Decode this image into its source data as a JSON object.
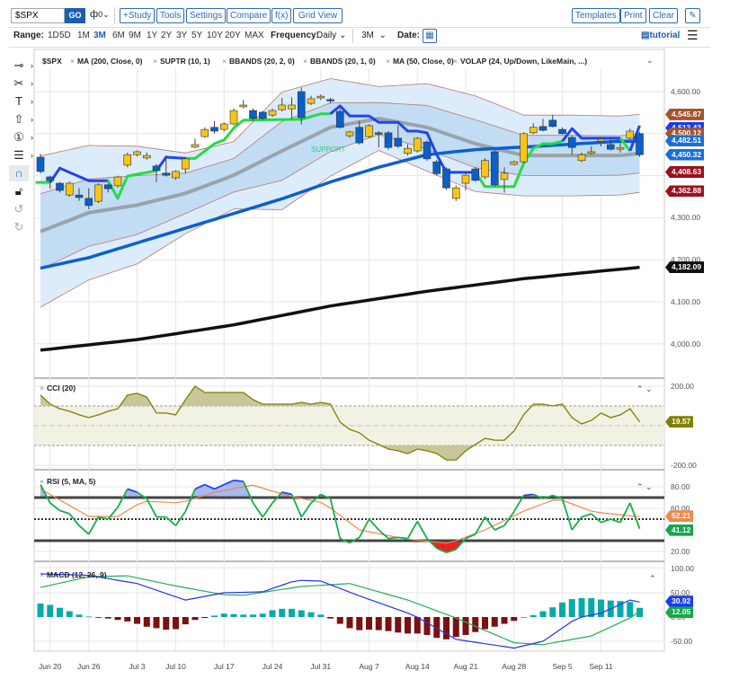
{
  "toolbar": {
    "symbol": "$SPX",
    "go": "GO",
    "chart_type_icon": "candlestick-icon",
    "buttons": [
      "+Study",
      "Tools",
      "Settings",
      "Compare",
      "f(x)",
      "Grid View"
    ],
    "right_buttons": [
      "Templates",
      "Print",
      "Clear"
    ],
    "edit_icon": "pencil-icon"
  },
  "range": {
    "label": "Range:",
    "items": [
      "1D",
      "5D",
      "1M",
      "3M",
      "6M",
      "9M",
      "1Y",
      "2Y",
      "3Y",
      "5Y",
      "10Y",
      "20Y",
      "MAX"
    ],
    "selected": "3M",
    "frequency_label": "Frequency:",
    "frequency": "Daily",
    "period": "3M",
    "date_label": "Date:",
    "tutorial": "tutorial"
  },
  "legend": {
    "symbol": "$SPX",
    "studies": [
      "MA (200, Close, 0)",
      "SUPTR (10, 1)",
      "BBANDS (20, 2, 0)",
      "BBANDS (20, 1, 0)",
      "MA (50, Close, 0)",
      "VOLAP (24, Up/Down, LikeMain, ...)"
    ]
  },
  "annotation": "SUPPORT",
  "tools": [
    "line-tool-icon",
    "scissors-icon",
    "text-icon",
    "arrow-up-icon",
    "numbered-marker-icon",
    "fib-lines-icon",
    "magnet-icon",
    "lock-icon",
    "undo-icon",
    "redo-icon"
  ],
  "colors": {
    "up": "#f5c518",
    "down": "#0a5fc8",
    "ma200": "#111111",
    "ma50": "#0a5fd0",
    "mid": "#9aa3ab",
    "suptr_up": "#22dd44",
    "suptr_down": "#2244ee"
  },
  "main_axis": [
    {
      "label": "4,600.00",
      "v": 4600
    },
    {
      "label": "4,300.00",
      "v": 4300
    },
    {
      "label": "4,200.00",
      "v": 4200
    },
    {
      "label": "4,100.00",
      "v": 4100
    },
    {
      "label": "4,000.00",
      "v": 4000
    }
  ],
  "price_tags": [
    {
      "label": "4,545.87",
      "v": 4545.87,
      "color": "#a5532a"
    },
    {
      "label": "4,513.43",
      "v": 4513.43,
      "color": "#1a3cf0"
    },
    {
      "label": "4,500.12",
      "v": 4500.12,
      "color": "#a5532a"
    },
    {
      "label": "4,482.51",
      "v": 4482.51,
      "color": "#1a6fd6"
    },
    {
      "label": "4,450.32",
      "v": 4450.32,
      "color": "#1a6fd6"
    },
    {
      "label": "4,408.63",
      "v": 4408.63,
      "color": "#9b111e"
    },
    {
      "label": "4,362.88",
      "v": 4362.88,
      "color": "#9b111e"
    },
    {
      "label": "4,182.09",
      "v": 4182.09,
      "color": "#111111"
    }
  ],
  "x_labels": [
    {
      "label": "Jun 20",
      "i": 1
    },
    {
      "label": "Jun 26",
      "i": 5
    },
    {
      "label": "Jul 3",
      "i": 10
    },
    {
      "label": "Jul 10",
      "i": 14
    },
    {
      "label": "Jul 17",
      "i": 19
    },
    {
      "label": "Jul 24",
      "i": 24
    },
    {
      "label": "Jul 31",
      "i": 29
    },
    {
      "label": "Aug 7",
      "i": 34
    },
    {
      "label": "Aug 14",
      "i": 39
    },
    {
      "label": "Aug 21",
      "i": 44
    },
    {
      "label": "Aug 28",
      "i": 49
    },
    {
      "label": "Sep 5",
      "i": 54
    },
    {
      "label": "Sep 11",
      "i": 58
    }
  ],
  "chart_data": {
    "type": "candlestick",
    "ohlc": [
      [
        4444,
        4452,
        4405,
        4410
      ],
      [
        4397,
        4400,
        4369,
        4388
      ],
      [
        4382,
        4385,
        4360,
        4365
      ],
      [
        4354,
        4386,
        4350,
        4382
      ],
      [
        4354,
        4370,
        4340,
        4348
      ],
      [
        4346,
        4370,
        4320,
        4329
      ],
      [
        4339,
        4382,
        4335,
        4378
      ],
      [
        4378,
        4382,
        4360,
        4369
      ],
      [
        4376,
        4400,
        4372,
        4397
      ],
      [
        4425,
        4455,
        4420,
        4450
      ],
      [
        4450,
        4460,
        4446,
        4457
      ],
      [
        4442,
        4455,
        4438,
        4448
      ],
      [
        4423,
        4428,
        4385,
        4412
      ],
      [
        4406,
        4448,
        4398,
        4401
      ],
      [
        4395,
        4413,
        4390,
        4410
      ],
      [
        4416,
        4445,
        4405,
        4440
      ],
      [
        4468,
        4488,
        4465,
        4474
      ],
      [
        4493,
        4515,
        4490,
        4510
      ],
      [
        4515,
        4530,
        4500,
        4506
      ],
      [
        4510,
        4527,
        4505,
        4523
      ],
      [
        4523,
        4560,
        4520,
        4555
      ],
      [
        4564,
        4580,
        4560,
        4568
      ],
      [
        4555,
        4560,
        4530,
        4536
      ],
      [
        4551,
        4554,
        4533,
        4536
      ],
      [
        4544,
        4560,
        4540,
        4555
      ],
      [
        4557,
        4585,
        4553,
        4568
      ],
      [
        4559,
        4586,
        4535,
        4568
      ],
      [
        4600,
        4610,
        4522,
        4538
      ],
      [
        4572,
        4590,
        4568,
        4583
      ],
      [
        4585,
        4593,
        4580,
        4589
      ],
      [
        4581,
        4585,
        4572,
        4580
      ],
      [
        4553,
        4560,
        4512,
        4515
      ],
      [
        4495,
        4507,
        4490,
        4504
      ],
      [
        4515,
        4530,
        4474,
        4478
      ],
      [
        4493,
        4522,
        4490,
        4519
      ],
      [
        4502,
        4506,
        4467,
        4501
      ],
      [
        4502,
        4506,
        4462,
        4467
      ],
      [
        4489,
        4520,
        4465,
        4470
      ],
      [
        4453,
        4475,
        4448,
        4465
      ],
      [
        4459,
        4492,
        4455,
        4489
      ],
      [
        4480,
        4484,
        4435,
        4440
      ],
      [
        4433,
        4438,
        4400,
        4405
      ],
      [
        4416,
        4420,
        4366,
        4371
      ],
      [
        4346,
        4377,
        4340,
        4371
      ],
      [
        4382,
        4410,
        4365,
        4401
      ],
      [
        4416,
        4420,
        4385,
        4389
      ],
      [
        4397,
        4442,
        4392,
        4436
      ],
      [
        4457,
        4461,
        4374,
        4378
      ],
      [
        4391,
        4420,
        4360,
        4406
      ],
      [
        4427,
        4436,
        4424,
        4433
      ],
      [
        4433,
        4503,
        4430,
        4500
      ],
      [
        4502,
        4525,
        4499,
        4515
      ],
      [
        4517,
        4535,
        4505,
        4508
      ],
      [
        4532,
        4545,
        4515,
        4517
      ],
      [
        4510,
        4515,
        4498,
        4500
      ],
      [
        4491,
        4495,
        4450,
        4467
      ],
      [
        4436,
        4455,
        4432,
        4450
      ],
      [
        4453,
        4470,
        4450,
        4457
      ],
      [
        4482,
        4492,
        4470,
        4487
      ],
      [
        4474,
        4487,
        4460,
        4463
      ],
      [
        4463,
        4478,
        4455,
        4467
      ],
      [
        4489,
        4512,
        4485,
        4506
      ],
      [
        4500,
        4504,
        4445,
        4450
      ]
    ],
    "ma200": [
      [
        0,
        3985
      ],
      [
        10,
        4010
      ],
      [
        20,
        4045
      ],
      [
        30,
        4090
      ],
      [
        40,
        4125
      ],
      [
        50,
        4155
      ],
      [
        62,
        4182
      ]
    ],
    "ma50": [
      [
        0,
        4180
      ],
      [
        5,
        4205
      ],
      [
        10,
        4240
      ],
      [
        15,
        4275
      ],
      [
        20,
        4310
      ],
      [
        25,
        4345
      ],
      [
        30,
        4385
      ],
      [
        35,
        4420
      ],
      [
        40,
        4450
      ],
      [
        45,
        4462
      ],
      [
        50,
        4468
      ],
      [
        55,
        4475
      ],
      [
        60,
        4482
      ],
      [
        62,
        4482
      ]
    ],
    "bb_mid": [
      [
        0,
        4267
      ],
      [
        5,
        4312
      ],
      [
        10,
        4330
      ],
      [
        15,
        4358
      ],
      [
        20,
        4401
      ],
      [
        25,
        4459
      ],
      [
        30,
        4515
      ],
      [
        35,
        4536
      ],
      [
        40,
        4515
      ],
      [
        45,
        4476
      ],
      [
        50,
        4448
      ],
      [
        55,
        4448
      ],
      [
        60,
        4448
      ],
      [
        62,
        4453
      ]
    ],
    "bb_sigma": [
      [
        0,
        90
      ],
      [
        5,
        80
      ],
      [
        10,
        70
      ],
      [
        15,
        48
      ],
      [
        20,
        40
      ],
      [
        25,
        70
      ],
      [
        30,
        58
      ],
      [
        35,
        38
      ],
      [
        40,
        52
      ],
      [
        45,
        57
      ],
      [
        50,
        48
      ],
      [
        55,
        48
      ],
      [
        60,
        47
      ],
      [
        62,
        46.4
      ]
    ],
    "suptr": [
      {
        "trend": "up",
        "pts": [
          [
            -0.5,
            4384
          ],
          [
            1,
            4384
          ]
        ]
      },
      {
        "trend": "down",
        "pts": [
          [
            1,
            4384
          ],
          [
            2,
            4418
          ],
          [
            5,
            4388
          ],
          [
            7,
            4388
          ]
        ]
      },
      {
        "trend": "up",
        "pts": [
          [
            7,
            4388
          ],
          [
            8,
            4346
          ],
          [
            9,
            4399
          ],
          [
            12,
            4412
          ]
        ]
      },
      {
        "trend": "down",
        "pts": [
          [
            12,
            4412
          ],
          [
            13,
            4444
          ],
          [
            15,
            4441
          ]
        ]
      },
      {
        "trend": "up",
        "pts": [
          [
            15,
            4441
          ],
          [
            16,
            4441
          ],
          [
            18,
            4476
          ],
          [
            19,
            4485
          ],
          [
            20,
            4513
          ],
          [
            21,
            4532
          ],
          [
            27,
            4534
          ],
          [
            29,
            4547
          ],
          [
            30,
            4547
          ]
        ]
      },
      {
        "trend": "down",
        "pts": [
          [
            30,
            4547
          ],
          [
            31,
            4566
          ],
          [
            32,
            4542
          ],
          [
            34,
            4542
          ],
          [
            35,
            4527
          ],
          [
            37,
            4527
          ],
          [
            38,
            4506
          ],
          [
            39,
            4506
          ],
          [
            40,
            4502
          ],
          [
            41,
            4450
          ],
          [
            42,
            4408
          ],
          [
            45,
            4408
          ]
        ]
      },
      {
        "trend": "up",
        "pts": [
          [
            45,
            4408
          ],
          [
            46,
            4374
          ],
          [
            48,
            4374
          ],
          [
            49,
            4374
          ],
          [
            50,
            4429
          ],
          [
            51,
            4465
          ],
          [
            52,
            4476
          ],
          [
            53,
            4476
          ],
          [
            54,
            4482
          ]
        ]
      },
      {
        "trend": "down",
        "pts": [
          [
            54,
            4482
          ],
          [
            55,
            4512
          ],
          [
            56,
            4489
          ],
          [
            60,
            4489
          ]
        ]
      },
      {
        "trend": "up",
        "pts": [
          [
            60,
            4489
          ],
          [
            61,
            4459
          ]
        ]
      },
      {
        "trend": "down",
        "pts": [
          [
            61,
            4459
          ],
          [
            62,
            4519
          ]
        ]
      }
    ],
    "ylim": [
      4000,
      4600
    ]
  },
  "cci": {
    "title": "CCI (20)",
    "axis": [
      "200.00",
      "-200.00"
    ],
    "tag": "19.57",
    "tag_color": "#808000",
    "values": [
      155,
      109,
      86,
      73,
      55,
      41,
      55,
      73,
      86,
      155,
      164,
      145,
      64,
      64,
      55,
      132,
      200,
      168,
      168,
      168,
      168,
      168,
      132,
      109,
      109,
      109,
      109,
      118,
      109,
      118,
      109,
      18,
      -18,
      -36,
      -73,
      -95,
      -118,
      -127,
      -141,
      -118,
      -127,
      -141,
      -173,
      -173,
      -127,
      -95,
      -64,
      -73,
      -73,
      -27,
      55,
      109,
      109,
      100,
      109,
      41,
      9,
      27,
      64,
      41,
      55,
      86,
      19.57
    ]
  },
  "rsi": {
    "title": "RSI (5, MA, 5)",
    "axis": [
      "80.00",
      "60.00",
      "20.00"
    ],
    "tags": [
      {
        "label": "52.21",
        "color": "#f0884a"
      },
      {
        "label": "41.12",
        "color": "#13a84a"
      }
    ],
    "values": [
      82,
      65,
      58,
      55,
      44,
      36,
      52,
      50,
      61,
      78,
      75,
      69,
      52,
      52,
      44,
      57,
      78,
      82,
      78,
      82,
      86,
      85,
      65,
      52,
      65,
      75,
      73,
      52,
      65,
      73,
      69,
      32,
      28,
      33,
      50,
      40,
      32,
      33,
      32,
      48,
      32,
      23,
      19,
      22,
      32,
      36,
      52,
      40,
      44,
      57,
      72,
      73,
      69,
      72,
      69,
      40,
      52,
      55,
      47,
      50,
      47,
      65,
      41.12
    ],
    "ma": [
      [
        0,
        78
      ],
      [
        5,
        52.5
      ],
      [
        8,
        52.5
      ],
      [
        10.6,
        66.7
      ],
      [
        14.4,
        65
      ],
      [
        18.1,
        75
      ],
      [
        21.9,
        81.7
      ],
      [
        25.6,
        71.7
      ],
      [
        29.3,
        65
      ],
      [
        33,
        40
      ],
      [
        37.7,
        31.7
      ],
      [
        42.3,
        27.5
      ],
      [
        46,
        40
      ],
      [
        49.8,
        56.7
      ],
      [
        53.5,
        69.2
      ],
      [
        57.2,
        56.7
      ],
      [
        62,
        52.21
      ]
    ]
  },
  "macd": {
    "title": "MACD (12, 26, 9)",
    "axis": [
      "100.00",
      "50.00",
      "0.00",
      "-50.00"
    ],
    "tags": [
      {
        "label": "30.92",
        "color": "#1a3cf0"
      },
      {
        "label": "12.05",
        "color": "#13a84a"
      }
    ],
    "hist": [
      28,
      25,
      19,
      12,
      5,
      1,
      -1,
      -3,
      -6,
      -9,
      -14,
      -20,
      -23,
      -26,
      -25,
      -15,
      -6,
      -2,
      3,
      7,
      6,
      5,
      5,
      7,
      14,
      17,
      17,
      14,
      10,
      5,
      -3,
      -14,
      -23,
      -27,
      -26,
      -27,
      -29,
      -32,
      -34,
      -34,
      -37,
      -43,
      -46,
      -41,
      -37,
      -31,
      -25,
      -20,
      -14,
      -8,
      0,
      4,
      12,
      20,
      30,
      37,
      39,
      39,
      36,
      34,
      33,
      31,
      19
    ],
    "line": [
      [
        0,
        89
      ],
      [
        5,
        86
      ],
      [
        10,
        69
      ],
      [
        15,
        35
      ],
      [
        19,
        50
      ],
      [
        23,
        52
      ],
      [
        26.5,
        76
      ],
      [
        29,
        74
      ],
      [
        33.5,
        40
      ],
      [
        38.6,
        4
      ],
      [
        43,
        -46
      ],
      [
        49,
        -64
      ],
      [
        52,
        -50
      ],
      [
        55.5,
        -2
      ],
      [
        58,
        8
      ],
      [
        61,
        35
      ],
      [
        62,
        30.92
      ]
    ],
    "signal": [
      [
        0,
        61
      ],
      [
        5,
        83
      ],
      [
        9,
        85
      ],
      [
        14,
        64
      ],
      [
        19,
        46
      ],
      [
        21,
        45
      ],
      [
        27,
        63
      ],
      [
        32,
        69
      ],
      [
        38,
        35
      ],
      [
        43,
        -2
      ],
      [
        49,
        -53
      ],
      [
        52,
        -57
      ],
      [
        57,
        -39
      ],
      [
        61,
        -2
      ],
      [
        62,
        12.05
      ]
    ]
  }
}
